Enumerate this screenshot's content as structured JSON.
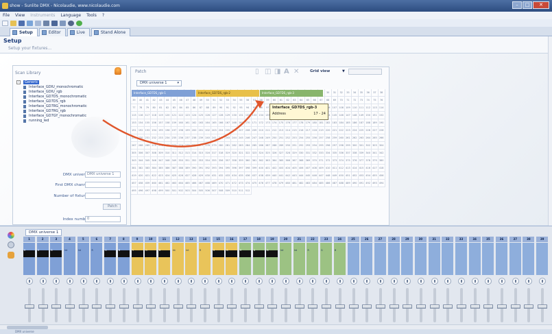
{
  "window": {
    "title": "show - Sunlite DMX - Nicolaudie, www.nicolaudie.com"
  },
  "menu": [
    "File",
    "View",
    "Instruments",
    "Language",
    "Tools",
    "?"
  ],
  "tabs": [
    {
      "label": "Setup",
      "active": true
    },
    {
      "label": "Editor",
      "active": false
    },
    {
      "label": "Live",
      "active": false
    },
    {
      "label": "Stand Alone",
      "active": false
    }
  ],
  "setup": {
    "title": "Setup",
    "subtitle": "Setup your fixtures..."
  },
  "library": {
    "title": "Scan Library",
    "root": "Generic",
    "items": [
      "Interface_GDIU_monochromatic",
      "Interface_GDIU_rgb",
      "Interface_GD7DS_monochromatic",
      "Interface_GD7DS_rgb",
      "Interface_GD7RG_monochromatic",
      "Interface_GD7RG_rgb",
      "Interface_GD7GY_monochromatic",
      "running_led"
    ]
  },
  "form": {
    "universe_label": "DMX universe",
    "universe_value": "DMX universe 1",
    "first_channel_label": "First DMX channel",
    "first_channel_value": "",
    "number_label": "Number of fixtures",
    "number_value": "",
    "patch_button": "Patch",
    "index_label": "Index number",
    "index_value": "0"
  },
  "patch": {
    "title": "Patch",
    "grid_view": "Grid view",
    "universe": "DMX universe 1",
    "fixtures": [
      {
        "label": "Interface_GD7DS_rgb-1",
        "color": "#7fa0d6"
      },
      {
        "label": "Interface_GD7DS_rgb-2",
        "color": "#e8c04a"
      },
      {
        "label": "Interface_GD7DS_rgb-3",
        "color": "#88b56c"
      }
    ],
    "tooltip": {
      "title": "Interface_GD7DS_rgb-3",
      "key": "Address",
      "value": "17 - 24"
    }
  },
  "bottom": {
    "tab": "DMX universe 1"
  },
  "status": "DMX universe",
  "channels": [
    {
      "n": "1",
      "c": "#7fa0d6",
      "b": true,
      "l": "R"
    },
    {
      "n": "2",
      "c": "#7fa0d6",
      "b": true,
      "l": "G"
    },
    {
      "n": "3",
      "c": "#7fa0d6",
      "b": true,
      "l": "B"
    },
    {
      "n": "4",
      "c": "#7fa0d6",
      "b": false,
      "l": "Int"
    },
    {
      "n": "5",
      "c": "#7fa0d6",
      "b": false,
      "l": "Int"
    },
    {
      "n": "6",
      "c": "#7fa0d6",
      "b": false,
      "l": "R"
    },
    {
      "n": "7",
      "c": "#7fa0d6",
      "b": true,
      "l": "G"
    },
    {
      "n": "8",
      "c": "#7fa0d6",
      "b": true,
      "l": "B"
    },
    {
      "n": "9",
      "c": "#e9c45a",
      "b": true,
      "l": "R"
    },
    {
      "n": "10",
      "c": "#e9c45a",
      "b": true,
      "l": "G"
    },
    {
      "n": "11",
      "c": "#e9c45a",
      "b": true,
      "l": "B"
    },
    {
      "n": "12",
      "c": "#e9c45a",
      "b": false,
      "l": "Int"
    },
    {
      "n": "13",
      "c": "#e9c45a",
      "b": false,
      "l": "Int"
    },
    {
      "n": "14",
      "c": "#e9c45a",
      "b": false,
      "l": "R"
    },
    {
      "n": "15",
      "c": "#e9c45a",
      "b": true,
      "l": "G"
    },
    {
      "n": "16",
      "c": "#e9c45a",
      "b": true,
      "l": "B"
    },
    {
      "n": "17",
      "c": "#9cc283",
      "b": true,
      "l": "R"
    },
    {
      "n": "18",
      "c": "#9cc283",
      "b": true,
      "l": "G"
    },
    {
      "n": "19",
      "c": "#9cc283",
      "b": true,
      "l": "B"
    },
    {
      "n": "20",
      "c": "#9cc283",
      "b": false,
      "l": "Int"
    },
    {
      "n": "21",
      "c": "#9cc283",
      "b": false,
      "l": "Int"
    },
    {
      "n": "22",
      "c": "#9cc283",
      "b": false,
      "l": "R"
    },
    {
      "n": "23",
      "c": "#9cc283",
      "b": false,
      "l": "G"
    },
    {
      "n": "24",
      "c": "#9cc283",
      "b": false,
      "l": "B"
    },
    {
      "n": "25",
      "c": "#8eaedc",
      "b": false,
      "l": ""
    },
    {
      "n": "26",
      "c": "#8eaedc",
      "b": false,
      "l": ""
    },
    {
      "n": "27",
      "c": "#8eaedc",
      "b": false,
      "l": ""
    },
    {
      "n": "28",
      "c": "#8eaedc",
      "b": false,
      "l": ""
    },
    {
      "n": "29",
      "c": "#8eaedc",
      "b": false,
      "l": ""
    },
    {
      "n": "30",
      "c": "#8eaedc",
      "b": false,
      "l": ""
    },
    {
      "n": "31",
      "c": "#8eaedc",
      "b": false,
      "l": ""
    },
    {
      "n": "32",
      "c": "#8eaedc",
      "b": false,
      "l": ""
    },
    {
      "n": "33",
      "c": "#8eaedc",
      "b": false,
      "l": ""
    },
    {
      "n": "34",
      "c": "#8eaedc",
      "b": false,
      "l": ""
    },
    {
      "n": "35",
      "c": "#8eaedc",
      "b": false,
      "l": ""
    },
    {
      "n": "36",
      "c": "#8eaedc",
      "b": false,
      "l": ""
    },
    {
      "n": "37",
      "c": "#8eaedc",
      "b": false,
      "l": ""
    },
    {
      "n": "38",
      "c": "#8eaedc",
      "b": false,
      "l": ""
    },
    {
      "n": "39",
      "c": "#8eaedc",
      "b": false,
      "l": ""
    }
  ]
}
